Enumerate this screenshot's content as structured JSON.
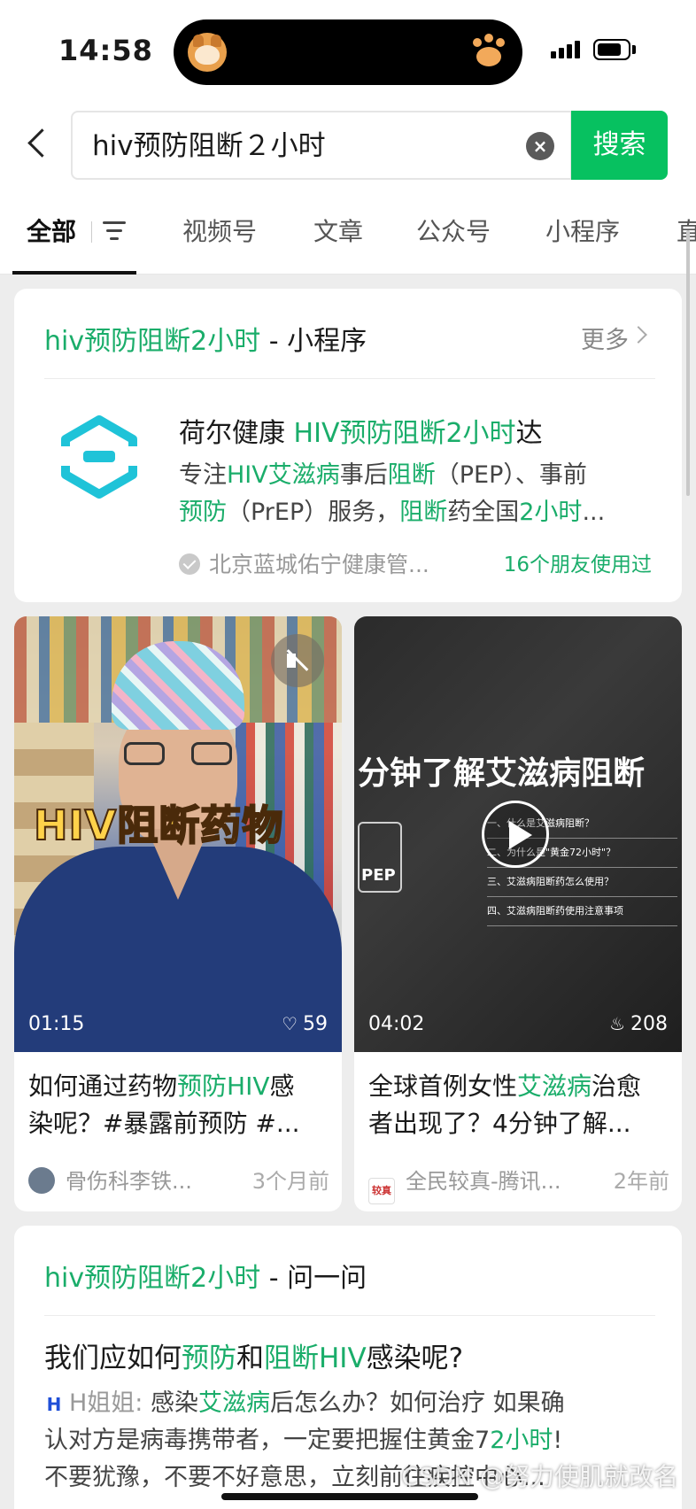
{
  "status": {
    "time": "14:58"
  },
  "search": {
    "query": "hiv预防阻断２小时",
    "button": "搜索"
  },
  "tabs": [
    {
      "label": "全部"
    },
    {
      "label": "视频号"
    },
    {
      "label": "文章"
    },
    {
      "label": "公众号"
    },
    {
      "label": "小程序"
    },
    {
      "label": "直"
    }
  ],
  "mini_program": {
    "section_keyword": "hiv预防阻断2小时",
    "section_suffix": " - 小程序",
    "more": "更多",
    "name_prefix": "荷尔健康 ",
    "name_hl": "HIV预防阻断2小时",
    "name_suffix": "达",
    "desc_line1": [
      "专注",
      "HIV艾滋病",
      "事后",
      "阻断",
      "（PEP）、事前"
    ],
    "desc_line2": [
      "预防",
      "（PrEP）服务，",
      "阻断",
      "药全国",
      "2小时",
      "..."
    ],
    "org": "北京蓝城佑宁健康管...",
    "friends": "16个朋友使用过"
  },
  "videos": [
    {
      "overlay": "HIV阻断药物",
      "duration": "01:15",
      "stat": "59",
      "stat_icon": "heart-icon",
      "title_line1": [
        "如何通过药物",
        "预防HIV",
        "感"
      ],
      "title_line2": "染呢？#暴露前预防 #...",
      "author": "骨伤科李铁...",
      "time": "3个月前"
    },
    {
      "overlay": "分钟了解艾滋病阻断",
      "jar_label": "PEP",
      "outline": [
        "一、什么是艾滋病阻断？",
        "二、为什么是\"黄金72小时\"？",
        "三、艾滋病阻断药怎么使用？",
        "四、艾滋病阻断药使用注意事项"
      ],
      "duration": "04:02",
      "stat": "208",
      "stat_icon": "flame-icon",
      "title_line1": [
        "全球首例女性",
        "艾滋病",
        "治愈"
      ],
      "title_line2": "者出现了？4分钟了解...",
      "author_badge": "较真",
      "author": "全民较真-腾讯...",
      "time": "2年前"
    }
  ],
  "qa": {
    "section_keyword": "hiv预防阻断2小时",
    "section_suffix": " - 问一问",
    "question": [
      "我们应如何",
      "预防",
      "和",
      "阻断HIV",
      "感染呢?"
    ],
    "answer_name": "H姐姐: ",
    "answer_line1": [
      "感染",
      "艾滋病",
      "后怎么办？如何治疗 如果确"
    ],
    "answer_line2": [
      "认对方是病毒携带者，一定要把握住黄金7",
      "2小时",
      "!"
    ],
    "answer_line3": "不要犹豫，不要不好意思，立刻前往疾控中心..."
  },
  "watermark": "CSDN @努力使肌就改名",
  "colors": {
    "accent": "#07c160",
    "highlight": "#1aad6a"
  }
}
